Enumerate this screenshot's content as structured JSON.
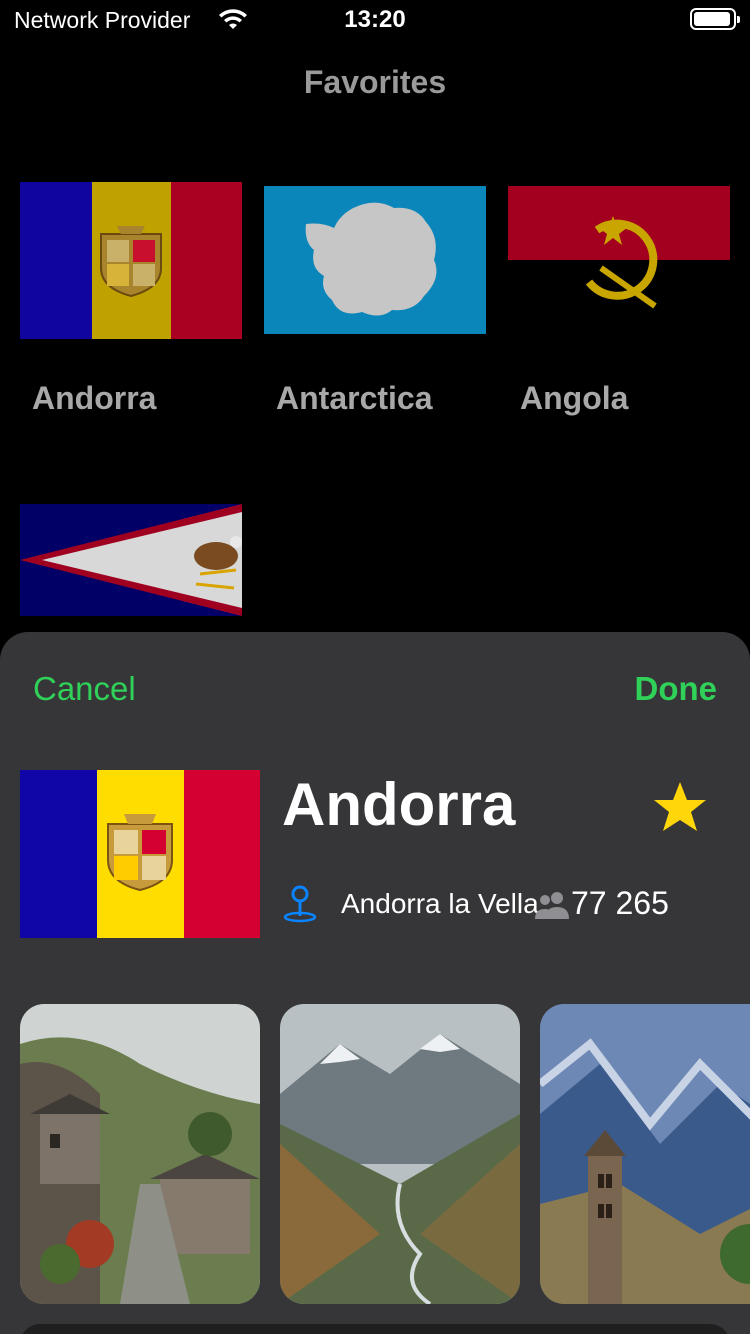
{
  "status_bar": {
    "carrier": "Network Provider",
    "time": "13:20"
  },
  "nav": {
    "title": "Favorites"
  },
  "favorites": [
    {
      "name": "Andorra",
      "flag_icon": "andorra-flag"
    },
    {
      "name": "Antarctica",
      "flag_icon": "antarctica-flag"
    },
    {
      "name": "Angola",
      "flag_icon": "angola-flag"
    },
    {
      "name": "",
      "flag_icon": "american-samoa-flag"
    }
  ],
  "sheet": {
    "cancel_label": "Cancel",
    "done_label": "Done",
    "country_name": "Andorra",
    "capital": "Andorra la Vella",
    "population": "77 265",
    "is_favorite": true,
    "photos": [
      {
        "subject": "stone-village-photo"
      },
      {
        "subject": "mountain-valley-photo"
      },
      {
        "subject": "bell-tower-photo"
      }
    ]
  },
  "colors": {
    "accent": "#30d158",
    "star": "#ffd60a",
    "pin": "#0a84ff",
    "sheet_bg": "#363638"
  }
}
